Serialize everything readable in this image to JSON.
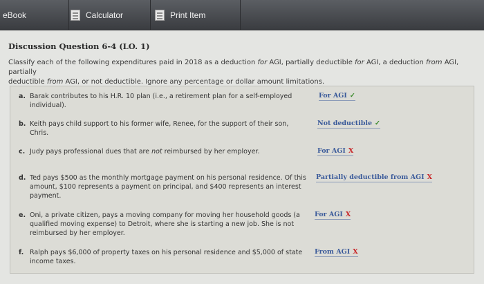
{
  "toolbar": {
    "ebook": "eBook",
    "calculator": "Calculator",
    "print_item": "Print Item"
  },
  "question": {
    "title": "Discussion Question 6-4 (LO. 1)",
    "instruction_1": "Classify each of the following expenditures paid in 2018 as a deduction for AGI, partially deductible for AGI, a deduction from AGI, partially",
    "instruction_2": "deductible from AGI, or not deductible. Ignore any percentage or dollar amount limitations."
  },
  "items": [
    {
      "letter": "a.",
      "line1": "Barak contributes to his H.R. 10 plan (i.e., a retirement plan for a self-employed",
      "line2": "individual).",
      "line3": "",
      "answer": "For AGI",
      "mark": "✓",
      "correct": true
    },
    {
      "letter": "b.",
      "line1": "Keith pays child support to his former wife, Renee, for the support of their son,",
      "line2": "Chris.",
      "line3": "",
      "answer": "Not deductible",
      "mark": "✓",
      "correct": true
    },
    {
      "letter": "c.",
      "line1": "Judy pays professional dues that are not reimbursed by her employer.",
      "line2": "",
      "line3": "",
      "answer": "For AGI",
      "mark": "X",
      "correct": false
    },
    {
      "letter": "d.",
      "line1": "Ted pays $500 as the monthly mortgage payment on his personal residence. Of this",
      "line2": "amount, $100 represents a payment on principal, and $400 represents an interest",
      "line3": "payment.",
      "answer": "Partially deductible from AGI",
      "mark": "X",
      "correct": false
    },
    {
      "letter": "e.",
      "line1": "Oni, a private citizen, pays a moving company for moving her household goods (a",
      "line2": "qualified moving expense) to Detroit, where she is starting a new job. She is not",
      "line3": "reimbursed by her employer.",
      "answer": "For AGI",
      "mark": "X",
      "correct": false
    },
    {
      "letter": "f.",
      "line1": "Ralph pays $6,000 of property taxes on his personal residence and $5,000 of state",
      "line2": "income taxes.",
      "line3": "",
      "answer": "From AGI",
      "mark": "X",
      "correct": false
    }
  ],
  "colors": {
    "correct": "#3a8a2a",
    "incorrect": "#c8282a",
    "answer": "#3a5a9a"
  }
}
